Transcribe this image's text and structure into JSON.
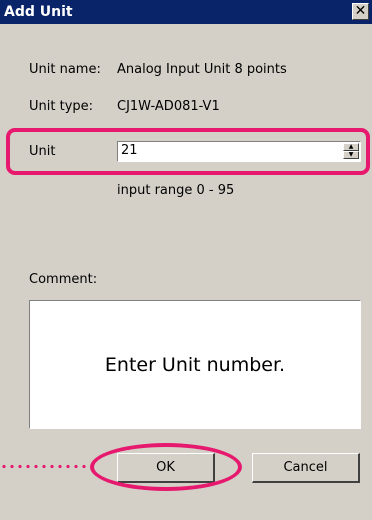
{
  "dialog": {
    "title": "Add Unit",
    "close_symbol": "✕"
  },
  "fields": {
    "unit_name_label": "Unit name:",
    "unit_name_value": "Analog Input Unit 8 points",
    "unit_type_label": "Unit type:",
    "unit_type_value": "CJ1W-AD081-V1",
    "unit_label": "Unit",
    "unit_value": "21",
    "input_range": "input range 0 - 95",
    "comment_label": "Comment:"
  },
  "annotation": {
    "callout_text": "Enter Unit number.",
    "highlight_color": "#e6196e"
  },
  "buttons": {
    "ok": "OK",
    "cancel": "Cancel"
  },
  "icons": {
    "spin_up": "spin-up-arrow-icon",
    "spin_down": "spin-down-arrow-icon",
    "close": "close-icon"
  }
}
